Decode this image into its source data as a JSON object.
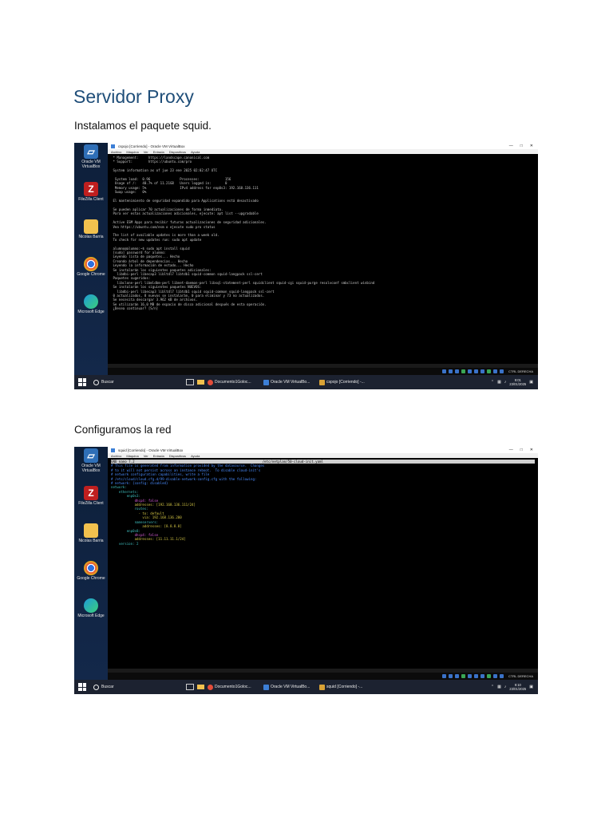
{
  "document": {
    "title": "Servidor Proxy",
    "para1": "Instalamos el paquete squid.",
    "para2": "Configuramos la red"
  },
  "desktop_icons": [
    {
      "label": "Oracle VM VirtualBox",
      "icon": "virtualbox-icon",
      "color": "#2f6fb7"
    },
    {
      "label": "FileZilla Client",
      "icon": "filezilla-icon",
      "color": "#bf1f1f"
    },
    {
      "label": "Nicolas Barria",
      "icon": "folder-icon",
      "color": "#f2c14e"
    },
    {
      "label": "Google Chrome",
      "icon": "chrome-icon",
      "color": "#e44d3a"
    },
    {
      "label": "Microsoft Edge",
      "icon": "edge-icon",
      "color": "#1f9bd8"
    }
  ],
  "vbox_menu": [
    "Archivo",
    "Máquina",
    "Ver",
    "Entrada",
    "Dispositivos",
    "Ayuda"
  ],
  "taskbar": {
    "search_label": "Buscar",
    "docs_app": "Documento1Goloc...",
    "vbox_app": "Oracle VM VirtualBo...",
    "host_key": "CTRL DERECHA"
  },
  "screenshot1": {
    "window_title": "cspojo [Corriendo] - Oracle VM VirtualBox",
    "vm_task": "cspojo [Corriendo] -...",
    "clock_time": "9:01",
    "clock_date": "23/01/2025",
    "terminal_lines": [
      " * Management:     https://landscape.canonical.com",
      " * Support:        https://ubuntu.com/pro",
      "",
      " System information as of jue 23 ene 2025 02:02:47 UTC",
      "",
      "  System load:  0.96               Processes:             156",
      "  Usage of /:   40.7% of 11.21GB   Users logged in:       0",
      "  Memory usage: 5%                 IPv4 address for enp0s3: 192.168.136.111",
      "  Swap usage:   0%",
      "",
      " El mantenimiento de seguridad expandido para Applications está desactivado",
      "",
      " Se pueden aplicar 70 actualizaciones de forma inmediata.",
      " Para ver estas actualizaciones adicionales, ejecute: apt list --upgradable",
      "",
      " Active ESM Apps para recibir futuras actualizaciones de seguridad adicionales.",
      " Vea https://ubuntu.com/esm o ejecute sudo pro status",
      "",
      " The list of available updates is more than a week old.",
      " To check for new updates run: sudo apt update",
      "",
      " alumno@alumno:~$ sudo apt install squid",
      " [sudo] password for alumno:",
      " Leyendo lista de paquetes... Hecho",
      " Creando árbol de dependencias... Hecho",
      " Leyendo la información de estado... Hecho",
      " Se instalarán los siguientes paquetes adicionales:",
      "   libdbi-perl libecap3 libltdl7 libtdb1 squid-common squid-langpack ssl-cert",
      " Paquetes sugeridos:",
      "   libclone-perl libmldbm-perl libnet-daemon-perl libsql-statement-perl squidclient squid-cgi squid-purge resolvconf smbclient winbind",
      " Se instalarán los siguientes paquetes NUEVOS:",
      "   libdbi-perl libecap3 libltdl7 libtdb1 squid squid-common squid-langpack ssl-cert",
      " 0 actualizados, 8 nuevos se instalarán, 0 para eliminar y 73 no actualizados.",
      " Se necesita descargar 3.962 kB de archivos.",
      " Se utilizarán 16,0 MB de espacio de disco adicional después de esta operación.",
      " ¿Desea continuar? [S/n]"
    ]
  },
  "screenshot2": {
    "window_title": "squid [Corriendo] - Oracle VM VirtualBox",
    "vm_task": "squid [Corriendo] -...",
    "clock_time": "9:10",
    "clock_date": "23/01/2025",
    "nano_left": " GNU nano 7.2",
    "nano_right": "/etc/netplan/50-cloud-init.yaml",
    "terminal_lines": [
      {
        "t": "# This file is generated from information provided by the datasource.  Changes",
        "c": "#4a8cff"
      },
      {
        "t": "# to it will not persist across an instance reboot.  To disable cloud-init's",
        "c": "#4a8cff"
      },
      {
        "t": "# network configuration capabilities, write a file",
        "c": "#4a8cff"
      },
      {
        "t": "# /etc/cloud/cloud.cfg.d/99-disable-network-config.cfg with the following:",
        "c": "#4a8cff"
      },
      {
        "t": "# network: {config: disabled}",
        "c": "#4a8cff"
      },
      {
        "t": "network:",
        "c": "#3fbfbf"
      },
      {
        "t": "    ethernets:",
        "c": "#3fbfbf"
      },
      {
        "t": "        enp0s3:",
        "c": "#3fbfbf"
      },
      {
        "t": "            dhcp4: false",
        "c": "#d65cd6"
      },
      {
        "t": "            addresses: [192.168.136.111/24]",
        "c": "#d6c845"
      },
      {
        "t": "            routes:",
        "c": "#3fbfbf"
      },
      {
        "t": "              - to: default",
        "c": "#d6c845"
      },
      {
        "t": "                via: 192.168.136.200",
        "c": "#d6c845"
      },
      {
        "t": "            nameservers:",
        "c": "#3fbfbf"
      },
      {
        "t": "                addresses: [8.8.8.8]",
        "c": "#d6c845"
      },
      {
        "t": "        enp0s8:",
        "c": "#3fbfbf"
      },
      {
        "t": "            dhcp4: false",
        "c": "#d65cd6"
      },
      {
        "t": "            addresses: [11.11.11.1/24]",
        "c": "#d6c845"
      },
      {
        "t": "    version: 2",
        "c": "#3fbfbf"
      }
    ]
  }
}
